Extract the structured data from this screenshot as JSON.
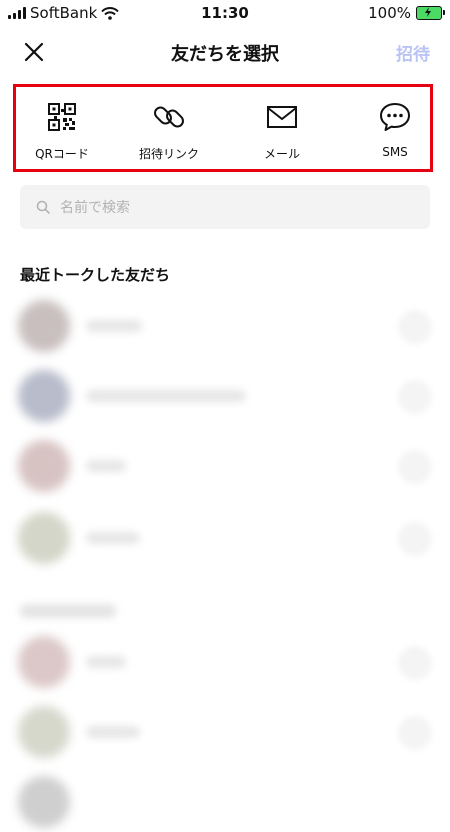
{
  "status_bar": {
    "carrier": "SoftBank",
    "time": "11:30",
    "battery": "100%"
  },
  "header": {
    "title": "友だちを選択",
    "invite_label": "招待"
  },
  "share_options": [
    {
      "label": "QRコード",
      "icon": "qr-code-icon"
    },
    {
      "label": "招待リンク",
      "icon": "link-icon"
    },
    {
      "label": "メール",
      "icon": "mail-icon"
    },
    {
      "label": "SMS",
      "icon": "message-icon"
    }
  ],
  "search": {
    "placeholder": "名前で検索"
  },
  "recent_section": {
    "title": "最近トークした友だち"
  },
  "colors": {
    "highlight_border": "#e60012",
    "invite_disabled": "#b9c3f4",
    "search_bg": "#f3f3f3"
  }
}
